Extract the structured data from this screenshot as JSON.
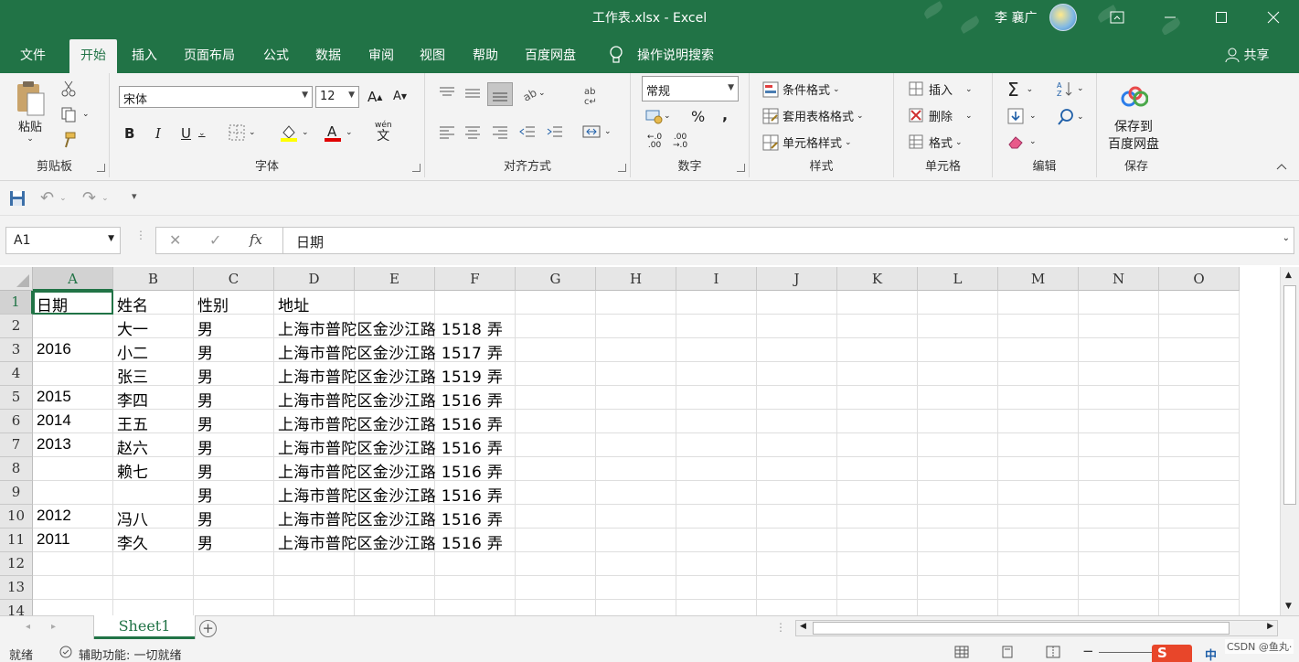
{
  "window": {
    "title": "工作表.xlsx  -  Excel",
    "user": "李 襄广",
    "controls": [
      "ribbon-display-icon",
      "minimize-icon",
      "maximize-icon",
      "close-icon"
    ]
  },
  "tabs": [
    {
      "label": "文件"
    },
    {
      "label": "开始",
      "active": true
    },
    {
      "label": "插入"
    },
    {
      "label": "页面布局"
    },
    {
      "label": "公式"
    },
    {
      "label": "数据"
    },
    {
      "label": "审阅"
    },
    {
      "label": "视图"
    },
    {
      "label": "帮助"
    },
    {
      "label": "百度网盘"
    },
    {
      "label": "操作说明搜索"
    }
  ],
  "share_label": "共享",
  "ribbon": {
    "clipboard": {
      "label": "剪贴板",
      "paste": "粘贴"
    },
    "font": {
      "label": "字体",
      "font_name": "宋体",
      "font_size": "12",
      "wen": "wén",
      "wen_char": "文"
    },
    "alignment": {
      "label": "对齐方式"
    },
    "number": {
      "label": "数字",
      "format": "常规"
    },
    "styles": {
      "label": "样式",
      "conditional": "条件格式",
      "table": "套用表格格式",
      "cell_style": "单元格样式"
    },
    "cells": {
      "label": "单元格",
      "insert": "插入",
      "delete": "删除",
      "format": "格式"
    },
    "editing": {
      "label": "编辑"
    },
    "save": {
      "label": "保存",
      "button_line1": "保存到",
      "button_line2": "百度网盘"
    }
  },
  "formula_bar": {
    "name_box": "A1",
    "fx": "fx",
    "content": "日期"
  },
  "columns": [
    "A",
    "B",
    "C",
    "D",
    "E",
    "F",
    "G",
    "H",
    "I",
    "J",
    "K",
    "L",
    "M",
    "N",
    "O"
  ],
  "rows": [
    {
      "n": "1",
      "a": "日期",
      "b": "姓名",
      "c": "性别",
      "d": "地址"
    },
    {
      "n": "2",
      "a": "",
      "b": "大一",
      "c": "男",
      "d": "上海市普陀区金沙江路  1518  弄"
    },
    {
      "n": "3",
      "a": "2016",
      "b": "小二",
      "c": "男",
      "d": "上海市普陀区金沙江路  1517  弄"
    },
    {
      "n": "4",
      "a": "",
      "b": "张三",
      "c": "男",
      "d": "上海市普陀区金沙江路  1519  弄"
    },
    {
      "n": "5",
      "a": "2015",
      "b": "李四",
      "c": "男",
      "d": "上海市普陀区金沙江路  1516  弄"
    },
    {
      "n": "6",
      "a": "2014",
      "b": "王五",
      "c": "男",
      "d": "上海市普陀区金沙江路  1516  弄"
    },
    {
      "n": "7",
      "a": "2013",
      "b": "赵六",
      "c": "男",
      "d": "上海市普陀区金沙江路  1516  弄"
    },
    {
      "n": "8",
      "a": "",
      "b": "赖七",
      "c": "男",
      "d": "上海市普陀区金沙江路  1516  弄"
    },
    {
      "n": "9",
      "a": "",
      "b": "",
      "c": "男",
      "d": "上海市普陀区金沙江路  1516  弄"
    },
    {
      "n": "10",
      "a": "2012",
      "b": "冯八",
      "c": "男",
      "d": "上海市普陀区金沙江路  1516  弄"
    },
    {
      "n": "11",
      "a": "2011",
      "b": "李久",
      "c": "男",
      "d": "上海市普陀区金沙江路  1516  弄"
    },
    {
      "n": "12",
      "a": "",
      "b": "",
      "c": "",
      "d": ""
    },
    {
      "n": "13",
      "a": "",
      "b": "",
      "c": "",
      "d": ""
    },
    {
      "n": "14",
      "a": "",
      "b": "",
      "c": "",
      "d": ""
    }
  ],
  "sheet_tab": "Sheet1",
  "status": {
    "ready": "就绪",
    "accessibility": "辅助功能: 一切就绪",
    "watermark": "CSDN @鱼丸·"
  },
  "colors": {
    "accent": "#217346"
  }
}
